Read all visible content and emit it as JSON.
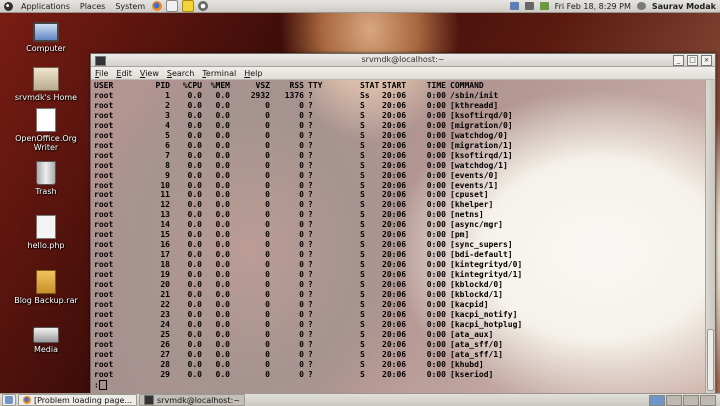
{
  "top_panel": {
    "menus": [
      "Applications",
      "Places",
      "System"
    ],
    "datetime": "Fri Feb 18,  8:29 PM",
    "user": "Saurav Modak"
  },
  "desktop_icons": [
    {
      "label": "Computer",
      "icon": "computer-icon"
    },
    {
      "label": "srvmdk's Home",
      "icon": "home-folder-icon"
    },
    {
      "label": "OpenOffice.Org Writer",
      "icon": "writer-document-icon"
    },
    {
      "label": "Trash",
      "icon": "trash-icon"
    },
    {
      "label": "hello.php",
      "icon": "php-file-icon"
    },
    {
      "label": "Blog Backup.rar",
      "icon": "archive-icon"
    },
    {
      "label": "Media",
      "icon": "drive-icon"
    }
  ],
  "terminal": {
    "title": "srvmdk@localhost:~",
    "menus": [
      "File",
      "Edit",
      "View",
      "Search",
      "Terminal",
      "Help"
    ],
    "header": [
      "USER",
      "PID",
      "%CPU",
      "%MEM",
      "VSZ",
      "RSS",
      "TTY",
      "STAT",
      "START",
      "TIME",
      "COMMAND"
    ],
    "rows": [
      [
        "root",
        "1",
        "0.0",
        "0.0",
        "2932",
        "1376",
        "?",
        "Ss",
        "20:06",
        "0:00",
        "/sbin/init"
      ],
      [
        "root",
        "2",
        "0.0",
        "0.0",
        "0",
        "0",
        "?",
        "S",
        "20:06",
        "0:00",
        "[kthreadd]"
      ],
      [
        "root",
        "3",
        "0.0",
        "0.0",
        "0",
        "0",
        "?",
        "S",
        "20:06",
        "0:00",
        "[ksoftirqd/0]"
      ],
      [
        "root",
        "4",
        "0.0",
        "0.0",
        "0",
        "0",
        "?",
        "S",
        "20:06",
        "0:00",
        "[migration/0]"
      ],
      [
        "root",
        "5",
        "0.0",
        "0.0",
        "0",
        "0",
        "?",
        "S",
        "20:06",
        "0:00",
        "[watchdog/0]"
      ],
      [
        "root",
        "6",
        "0.0",
        "0.0",
        "0",
        "0",
        "?",
        "S",
        "20:06",
        "0:00",
        "[migration/1]"
      ],
      [
        "root",
        "7",
        "0.0",
        "0.0",
        "0",
        "0",
        "?",
        "S",
        "20:06",
        "0:00",
        "[ksoftirqd/1]"
      ],
      [
        "root",
        "8",
        "0.0",
        "0.0",
        "0",
        "0",
        "?",
        "S",
        "20:06",
        "0:00",
        "[watchdog/1]"
      ],
      [
        "root",
        "9",
        "0.0",
        "0.0",
        "0",
        "0",
        "?",
        "S",
        "20:06",
        "0:00",
        "[events/0]"
      ],
      [
        "root",
        "10",
        "0.0",
        "0.0",
        "0",
        "0",
        "?",
        "S",
        "20:06",
        "0:00",
        "[events/1]"
      ],
      [
        "root",
        "11",
        "0.0",
        "0.0",
        "0",
        "0",
        "?",
        "S",
        "20:06",
        "0:00",
        "[cpuset]"
      ],
      [
        "root",
        "12",
        "0.0",
        "0.0",
        "0",
        "0",
        "?",
        "S",
        "20:06",
        "0:00",
        "[khelper]"
      ],
      [
        "root",
        "13",
        "0.0",
        "0.0",
        "0",
        "0",
        "?",
        "S",
        "20:06",
        "0:00",
        "[netns]"
      ],
      [
        "root",
        "14",
        "0.0",
        "0.0",
        "0",
        "0",
        "?",
        "S",
        "20:06",
        "0:00",
        "[async/mgr]"
      ],
      [
        "root",
        "15",
        "0.0",
        "0.0",
        "0",
        "0",
        "?",
        "S",
        "20:06",
        "0:00",
        "[pm]"
      ],
      [
        "root",
        "16",
        "0.0",
        "0.0",
        "0",
        "0",
        "?",
        "S",
        "20:06",
        "0:00",
        "[sync_supers]"
      ],
      [
        "root",
        "17",
        "0.0",
        "0.0",
        "0",
        "0",
        "?",
        "S",
        "20:06",
        "0:00",
        "[bdi-default]"
      ],
      [
        "root",
        "18",
        "0.0",
        "0.0",
        "0",
        "0",
        "?",
        "S",
        "20:06",
        "0:00",
        "[kintegrityd/0]"
      ],
      [
        "root",
        "19",
        "0.0",
        "0.0",
        "0",
        "0",
        "?",
        "S",
        "20:06",
        "0:00",
        "[kintegrityd/1]"
      ],
      [
        "root",
        "20",
        "0.0",
        "0.0",
        "0",
        "0",
        "?",
        "S",
        "20:06",
        "0:00",
        "[kblockd/0]"
      ],
      [
        "root",
        "21",
        "0.0",
        "0.0",
        "0",
        "0",
        "?",
        "S",
        "20:06",
        "0:00",
        "[kblockd/1]"
      ],
      [
        "root",
        "22",
        "0.0",
        "0.0",
        "0",
        "0",
        "?",
        "S",
        "20:06",
        "0:00",
        "[kacpid]"
      ],
      [
        "root",
        "23",
        "0.0",
        "0.0",
        "0",
        "0",
        "?",
        "S",
        "20:06",
        "0:00",
        "[kacpi_notify]"
      ],
      [
        "root",
        "24",
        "0.0",
        "0.0",
        "0",
        "0",
        "?",
        "S",
        "20:06",
        "0:00",
        "[kacpi_hotplug]"
      ],
      [
        "root",
        "25",
        "0.0",
        "0.0",
        "0",
        "0",
        "?",
        "S",
        "20:06",
        "0:00",
        "[ata_aux]"
      ],
      [
        "root",
        "26",
        "0.0",
        "0.0",
        "0",
        "0",
        "?",
        "S",
        "20:06",
        "0:00",
        "[ata_sff/0]"
      ],
      [
        "root",
        "27",
        "0.0",
        "0.0",
        "0",
        "0",
        "?",
        "S",
        "20:06",
        "0:00",
        "[ata_sff/1]"
      ],
      [
        "root",
        "28",
        "0.0",
        "0.0",
        "0",
        "0",
        "?",
        "S",
        "20:06",
        "0:00",
        "[khubd]"
      ],
      [
        "root",
        "29",
        "0.0",
        "0.0",
        "0",
        "0",
        "?",
        "S",
        "20:06",
        "0:00",
        "[kseriod]"
      ]
    ],
    "prompt": ":"
  },
  "taskbar": {
    "tasks": [
      {
        "label": "[Problem loading page...",
        "icon": "firefox-icon",
        "active": false
      },
      {
        "label": "srvmdk@localhost:~",
        "icon": "terminal-icon",
        "active": true
      }
    ]
  },
  "colors": {
    "panel": "#d9d6d0",
    "terminal_text": "#000000",
    "wallpaper_dark": "#3a0c08"
  }
}
